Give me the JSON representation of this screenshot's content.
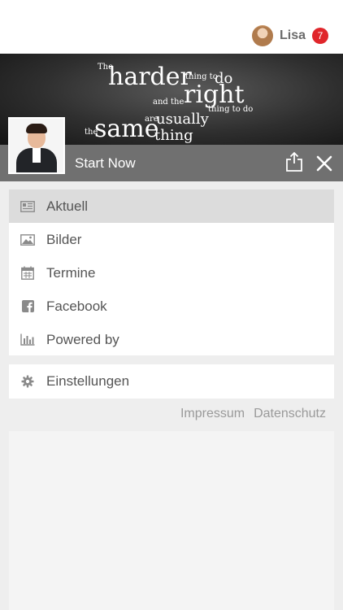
{
  "user": {
    "name": "Lisa",
    "notification_count": "7"
  },
  "banner": {
    "quote": {
      "the1": "The",
      "harder": "harder",
      "thing_to": "thing to",
      "do1": "do",
      "and_the": "and the",
      "right": "right",
      "thing_to_do": "thing to do",
      "are": "are",
      "usually": "usually",
      "the2": "the",
      "same": "same",
      "thing": "thing"
    }
  },
  "header": {
    "title": "Start Now"
  },
  "menu": {
    "items": [
      {
        "label": "Aktuell",
        "icon": "newspaper-icon",
        "active": true
      },
      {
        "label": "Bilder",
        "icon": "image-icon"
      },
      {
        "label": "Termine",
        "icon": "calendar-icon"
      },
      {
        "label": "Facebook",
        "icon": "facebook-icon"
      },
      {
        "label": "Powered by",
        "icon": "bar-chart-icon"
      }
    ]
  },
  "settings": {
    "label": "Einstellungen",
    "icon": "gear-icon"
  },
  "footer_links": {
    "impressum": "Impressum",
    "datenschutz": "Datenschutz"
  },
  "colors": {
    "badge": "#e0262b",
    "header_strip": "#707070",
    "active_item": "#dcdcdc"
  }
}
